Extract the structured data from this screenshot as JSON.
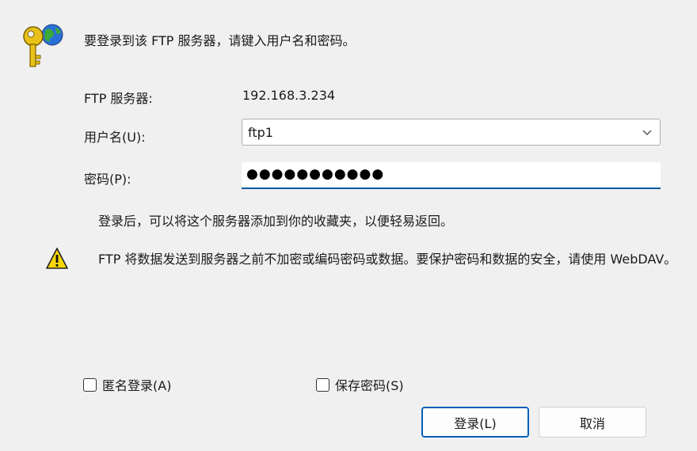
{
  "dialog": {
    "intro": "要登录到该 FTP 服务器，请键入用户名和密码。",
    "server_label": "FTP 服务器:",
    "server_value": "192.168.3.234",
    "username_label": "用户名(U):",
    "username_value": "ftp1",
    "password_label": "密码(P):",
    "password_value": "●●●●●●●●●●●",
    "favorites_note": "登录后，可以将这个服务器添加到你的收藏夹，以便轻易返回。",
    "warning_text": "FTP 将数据发送到服务器之前不加密或编码密码或数据。要保护密码和数据的安全，请使用 WebDAV。",
    "anonymous_label": "匿名登录(A)",
    "anonymous_checked": false,
    "save_password_label": "保存密码(S)",
    "save_password_checked": false,
    "login_button": "登录(L)",
    "cancel_button": "取消"
  },
  "icons": {
    "key": "key-globe-icon",
    "warning": "warning-icon",
    "dropdown": "chevron-down-icon"
  },
  "colors": {
    "accent": "#005fb8",
    "background": "#f0f0f0",
    "key_gold": "#e8c21a",
    "warning_yellow": "#f6d800"
  }
}
